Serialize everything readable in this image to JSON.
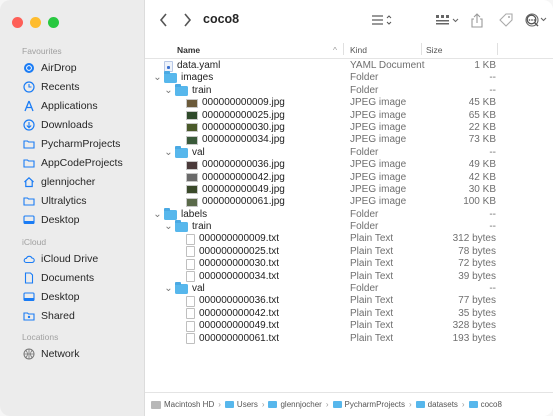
{
  "window": {
    "title": "coco8",
    "toolbar": {
      "back_icon": "chevron-left-icon",
      "forward_icon": "chevron-right-icon",
      "list_view_icon": "list-view-icon",
      "group_icon": "group-icon",
      "share_icon": "share-icon",
      "tag_icon": "tag-icon",
      "more_icon": "ellipsis-circle-icon",
      "search_icon": "search-icon"
    }
  },
  "sidebar": {
    "sections": [
      {
        "header": "Favourites",
        "items": [
          {
            "label": "AirDrop",
            "icon": "airdrop-icon"
          },
          {
            "label": "Recents",
            "icon": "clock-icon"
          },
          {
            "label": "Applications",
            "icon": "applications-icon"
          },
          {
            "label": "Downloads",
            "icon": "download-icon"
          },
          {
            "label": "PycharmProjects",
            "icon": "folder-icon"
          },
          {
            "label": "AppCodeProjects",
            "icon": "folder-icon"
          },
          {
            "label": "glennjocher",
            "icon": "home-icon"
          },
          {
            "label": "Ultralytics",
            "icon": "folder-icon"
          },
          {
            "label": "Desktop",
            "icon": "desktop-icon"
          }
        ]
      },
      {
        "header": "iCloud",
        "items": [
          {
            "label": "iCloud Drive",
            "icon": "cloud-icon"
          },
          {
            "label": "Documents",
            "icon": "document-icon"
          },
          {
            "label": "Desktop",
            "icon": "desktop-icon"
          },
          {
            "label": "Shared",
            "icon": "shared-folder-icon"
          }
        ]
      },
      {
        "header": "Locations",
        "items": [
          {
            "label": "Network",
            "icon": "network-icon"
          }
        ]
      }
    ]
  },
  "columns": {
    "name": "Name",
    "kind": "Kind",
    "size": "Size"
  },
  "files": [
    {
      "name": "data.yaml",
      "kind": "YAML Document",
      "size": "1 KB",
      "type": "yaml",
      "level": 0
    },
    {
      "name": "images",
      "kind": "Folder",
      "size": "--",
      "type": "folder",
      "level": 0,
      "expanded": true
    },
    {
      "name": "train",
      "kind": "Folder",
      "size": "--",
      "type": "folder",
      "level": 1,
      "expanded": true
    },
    {
      "name": "000000000009.jpg",
      "kind": "JPEG image",
      "size": "45 KB",
      "type": "image",
      "level": 2
    },
    {
      "name": "000000000025.jpg",
      "kind": "JPEG image",
      "size": "65 KB",
      "type": "image",
      "level": 2
    },
    {
      "name": "000000000030.jpg",
      "kind": "JPEG image",
      "size": "22 KB",
      "type": "image",
      "level": 2
    },
    {
      "name": "000000000034.jpg",
      "kind": "JPEG image",
      "size": "73 KB",
      "type": "image",
      "level": 2
    },
    {
      "name": "val",
      "kind": "Folder",
      "size": "--",
      "type": "folder",
      "level": 1,
      "expanded": true
    },
    {
      "name": "000000000036.jpg",
      "kind": "JPEG image",
      "size": "49 KB",
      "type": "image",
      "level": 2
    },
    {
      "name": "000000000042.jpg",
      "kind": "JPEG image",
      "size": "42 KB",
      "type": "image",
      "level": 2
    },
    {
      "name": "000000000049.jpg",
      "kind": "JPEG image",
      "size": "30 KB",
      "type": "image",
      "level": 2
    },
    {
      "name": "000000000061.jpg",
      "kind": "JPEG image",
      "size": "100 KB",
      "type": "image",
      "level": 2
    },
    {
      "name": "labels",
      "kind": "Folder",
      "size": "--",
      "type": "folder",
      "level": 0,
      "expanded": true
    },
    {
      "name": "train",
      "kind": "Folder",
      "size": "--",
      "type": "folder",
      "level": 1,
      "expanded": true
    },
    {
      "name": "000000000009.txt",
      "kind": "Plain Text",
      "size": "312 bytes",
      "type": "text",
      "level": 2
    },
    {
      "name": "000000000025.txt",
      "kind": "Plain Text",
      "size": "78 bytes",
      "type": "text",
      "level": 2
    },
    {
      "name": "000000000030.txt",
      "kind": "Plain Text",
      "size": "72 bytes",
      "type": "text",
      "level": 2
    },
    {
      "name": "000000000034.txt",
      "kind": "Plain Text",
      "size": "39 bytes",
      "type": "text",
      "level": 2
    },
    {
      "name": "val",
      "kind": "Folder",
      "size": "--",
      "type": "folder",
      "level": 1,
      "expanded": true
    },
    {
      "name": "000000000036.txt",
      "kind": "Plain Text",
      "size": "77 bytes",
      "type": "text",
      "level": 2
    },
    {
      "name": "000000000042.txt",
      "kind": "Plain Text",
      "size": "35 bytes",
      "type": "text",
      "level": 2
    },
    {
      "name": "000000000049.txt",
      "kind": "Plain Text",
      "size": "328 bytes",
      "type": "text",
      "level": 2
    },
    {
      "name": "000000000061.txt",
      "kind": "Plain Text",
      "size": "193 bytes",
      "type": "text",
      "level": 2
    }
  ],
  "pathbar": [
    "Macintosh HD",
    "Users",
    "glennjocher",
    "PycharmProjects",
    "datasets",
    "coco8"
  ],
  "colors": {
    "folder": "#57b7ec",
    "sidebar_icon": "#1a7cf5",
    "red": "#fe5f57",
    "yellow": "#febc2e",
    "green": "#28c840"
  }
}
